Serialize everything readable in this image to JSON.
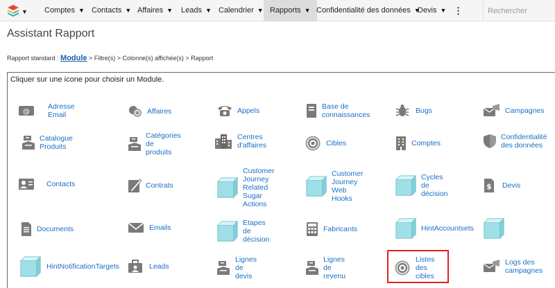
{
  "nav": {
    "items": [
      "Comptes",
      "Contacts",
      "Affaires",
      "Leads",
      "Calendrier",
      "Rapports",
      "Confidentialité des données",
      "Devis"
    ],
    "active": "Rapports",
    "search_placeholder": "Rechercher"
  },
  "page": {
    "title": "Assistant Rapport",
    "breadcrumb_prefix": "Rapport standard : ",
    "breadcrumb_link": "Module",
    "breadcrumb_suffix": " > Filtre(s) > Colonne(s) affichée(s) > Rapport",
    "instruction": "Cliquer sur une icone pour choisir un Module."
  },
  "modules": [
    {
      "label": "Adresse\nEmail",
      "icon": "email-address-icon"
    },
    {
      "label": "Affaires",
      "icon": "coins-icon"
    },
    {
      "label": "Appels",
      "icon": "phone-icon"
    },
    {
      "label": "Base de\nconnaissances",
      "icon": "book-icon"
    },
    {
      "label": "Bugs",
      "icon": "bug-icon"
    },
    {
      "label": "Campagnes",
      "icon": "campaign-icon"
    },
    {
      "label": "Catalogue\nProduits",
      "icon": "product-icon"
    },
    {
      "label": "Catégories\nde\nproduits",
      "icon": "product-icon"
    },
    {
      "label": "Centres\nd'affaires",
      "icon": "buildings-icon"
    },
    {
      "label": "Cibles",
      "icon": "target-icon"
    },
    {
      "label": "Comptes",
      "icon": "building-icon"
    },
    {
      "label": "Confidentialité\ndes données",
      "icon": "shield-icon"
    },
    {
      "label": "Contacts",
      "icon": "contact-card-icon"
    },
    {
      "label": "Contrats",
      "icon": "contract-icon"
    },
    {
      "label": "Customer\nJourney\nRelated\nSugar\nActions",
      "icon": "cube-icon"
    },
    {
      "label": "Customer\nJourney\nWeb\nHooks",
      "icon": "cube-icon"
    },
    {
      "label": "Cycles\nde\ndécision",
      "icon": "cube-icon"
    },
    {
      "label": "Devis",
      "icon": "quote-icon"
    },
    {
      "label": "Documents",
      "icon": "document-icon"
    },
    {
      "label": "Emails",
      "icon": "envelope-icon"
    },
    {
      "label": "Etapes\nde\ndécision",
      "icon": "cube-icon"
    },
    {
      "label": "Fabricants",
      "icon": "calculator-icon"
    },
    {
      "label": "HintAccountsets",
      "icon": "cube-icon"
    },
    {
      "label": "",
      "icon": "cube-icon"
    },
    {
      "label": "HintNotificationTargets",
      "icon": "cube-icon"
    },
    {
      "label": "Leads",
      "icon": "leads-icon"
    },
    {
      "label": "Lignes\nde\ndevis",
      "icon": "product-icon"
    },
    {
      "label": "Lignes\nde\nrevenu",
      "icon": "product-icon"
    },
    {
      "label": "Listes\ndes\ncibles",
      "icon": "target-icon"
    },
    {
      "label": "Logs des\ncampagnes",
      "icon": "campaign-icon"
    }
  ]
}
